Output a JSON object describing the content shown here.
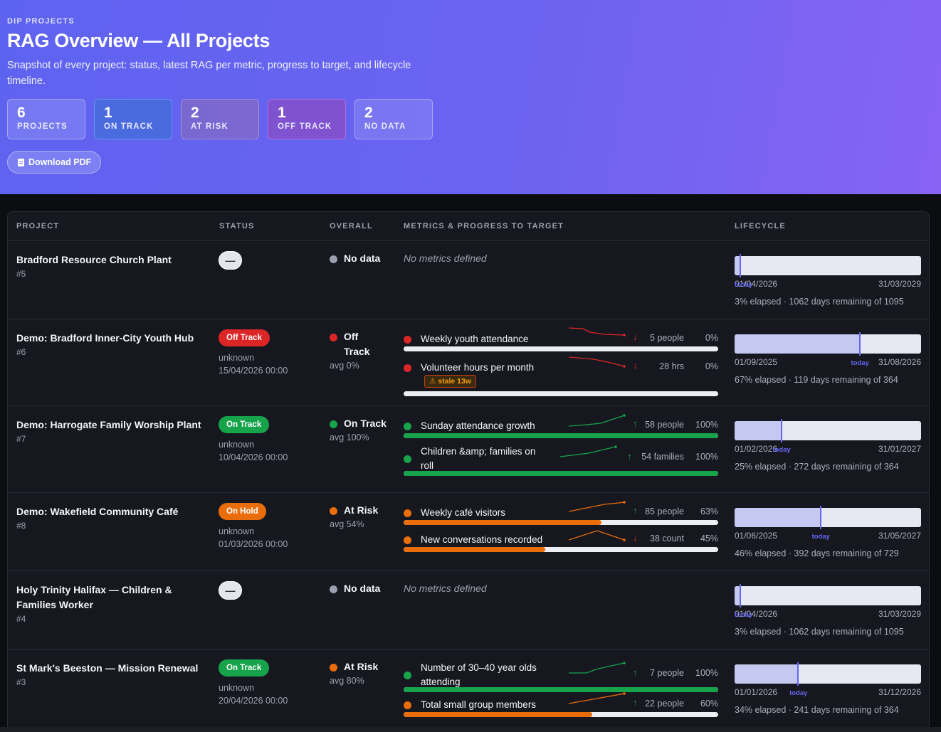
{
  "header": {
    "eyebrow": "DIP PROJECTS",
    "title": "RAG Overview — All Projects",
    "subtitle": "Snapshot of every project: status, latest RAG per metric, progress to target, and lifecycle timeline.",
    "download_label": "Download PDF"
  },
  "stats": [
    {
      "num": "6",
      "label": "PROJECTS"
    },
    {
      "num": "1",
      "label": "ON TRACK"
    },
    {
      "num": "2",
      "label": "AT RISK"
    },
    {
      "num": "1",
      "label": "OFF TRACK"
    },
    {
      "num": "2",
      "label": "NO DATA"
    }
  ],
  "columns": [
    "PROJECT",
    "STATUS",
    "OVERALL",
    "METRICS & PROGRESS TO TARGET",
    "LIFECYCLE"
  ],
  "colors": {
    "on_track": "#16a34a",
    "at_risk": "#ea6d0c",
    "off_track": "#dc2626",
    "no_data": "#9aa0ae",
    "accent": "#6366f1"
  },
  "projects": [
    {
      "name": "Bradford Resource Church Plant",
      "id": "#5",
      "status": {
        "pill": "—",
        "kind": "none",
        "meta1": "",
        "meta2": ""
      },
      "overall": {
        "label": "No data",
        "avg": "",
        "rag": "grey"
      },
      "no_metrics": "No metrics defined",
      "metrics": [],
      "lifecycle": {
        "start": "01/04/2026",
        "end": "31/03/2029",
        "today_label": "today",
        "elapsed": 0.03,
        "summary": "3% elapsed · 1062 days remaining of 1095"
      }
    },
    {
      "name": "Demo: Bradford Inner-City Youth Hub",
      "id": "#6",
      "status": {
        "pill": "Off Track",
        "kind": "off",
        "meta1": "unknown",
        "meta2": "15/04/2026 00:00"
      },
      "overall": {
        "label": "Off Track",
        "avg": "avg 0%",
        "rag": "red"
      },
      "no_metrics": "",
      "metrics": [
        {
          "name": "Weekly youth attendance",
          "rag": "red",
          "trend": "down",
          "value": "5 people",
          "pct": "0%",
          "progress": 0,
          "stale": ""
        },
        {
          "name": "Volunteer hours per month",
          "rag": "red",
          "trend": "down",
          "value": "28 hrs",
          "pct": "0%",
          "progress": 0,
          "stale": "⚠ stale 13w"
        }
      ],
      "lifecycle": {
        "start": "01/09/2025",
        "end": "31/08/2026",
        "today_label": "today",
        "elapsed": 0.67,
        "summary": "67% elapsed · 119 days remaining of 364"
      }
    },
    {
      "name": "Demo: Harrogate Family Worship Plant",
      "id": "#7",
      "status": {
        "pill": "On Track",
        "kind": "on",
        "meta1": "unknown",
        "meta2": "10/04/2026 00:00"
      },
      "overall": {
        "label": "On Track",
        "avg": "avg 100%",
        "rag": "green"
      },
      "no_metrics": "",
      "metrics": [
        {
          "name": "Sunday attendance growth",
          "rag": "green",
          "trend": "up",
          "value": "58 people",
          "pct": "100%",
          "progress": 1.0,
          "stale": ""
        },
        {
          "name": "Children &amp; families on roll",
          "rag": "green",
          "trend": "up",
          "value": "54 families",
          "pct": "100%",
          "progress": 1.0,
          "stale": ""
        }
      ],
      "lifecycle": {
        "start": "01/02/2026",
        "end": "31/01/2027",
        "today_label": "today",
        "elapsed": 0.25,
        "summary": "25% elapsed · 272 days remaining of 364"
      }
    },
    {
      "name": "Demo: Wakefield Community Café",
      "id": "#8",
      "status": {
        "pill": "On Hold",
        "kind": "hold",
        "meta1": "unknown",
        "meta2": "01/03/2026 00:00"
      },
      "overall": {
        "label": "At Risk",
        "avg": "avg 54%",
        "rag": "orange"
      },
      "no_metrics": "",
      "metrics": [
        {
          "name": "Weekly café visitors",
          "rag": "orange",
          "trend": "up",
          "value": "85 people",
          "pct": "63%",
          "progress": 0.63,
          "stale": ""
        },
        {
          "name": "New conversations recorded",
          "rag": "orange",
          "trend": "down",
          "value": "38 count",
          "pct": "45%",
          "progress": 0.45,
          "stale": ""
        }
      ],
      "lifecycle": {
        "start": "01/06/2025",
        "end": "31/05/2027",
        "today_label": "today",
        "elapsed": 0.46,
        "summary": "46% elapsed · 392 days remaining of 729"
      }
    },
    {
      "name": "Holy Trinity Halifax — Children & Families Worker",
      "id": "#4",
      "status": {
        "pill": "—",
        "kind": "none",
        "meta1": "",
        "meta2": ""
      },
      "overall": {
        "label": "No data",
        "avg": "",
        "rag": "grey"
      },
      "no_metrics": "No metrics defined",
      "metrics": [],
      "lifecycle": {
        "start": "01/04/2026",
        "end": "31/03/2029",
        "today_label": "today",
        "elapsed": 0.03,
        "summary": "3% elapsed · 1062 days remaining of 1095"
      }
    },
    {
      "name": "St Mark's Beeston — Mission Renewal",
      "id": "#3",
      "status": {
        "pill": "On Track",
        "kind": "on",
        "meta1": "unknown",
        "meta2": "20/04/2026 00:00"
      },
      "overall": {
        "label": "At Risk",
        "avg": "avg 80%",
        "rag": "orange"
      },
      "no_metrics": "",
      "metrics": [
        {
          "name": "Number of 30–40 year olds attending",
          "rag": "green",
          "trend": "up",
          "value": "7 people",
          "pct": "100%",
          "progress": 1.0,
          "stale": ""
        },
        {
          "name": "Total small group members",
          "rag": "orange",
          "trend": "up",
          "value": "22 people",
          "pct": "60%",
          "progress": 0.6,
          "stale": ""
        }
      ],
      "lifecycle": {
        "start": "01/01/2026",
        "end": "31/12/2026",
        "today_label": "today",
        "elapsed": 0.34,
        "summary": "34% elapsed · 241 days remaining of 364"
      }
    }
  ]
}
